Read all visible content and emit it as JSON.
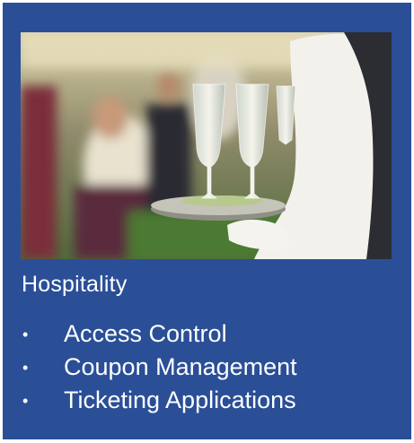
{
  "card": {
    "background": "#2a4f97",
    "image_subject": "waiter-tray-champagne-flutes",
    "title": "Hospitality",
    "bullet_glyph": "•",
    "items": [
      {
        "label": "Access Control"
      },
      {
        "label": "Coupon Management"
      },
      {
        "label": "Ticketing Applications"
      }
    ]
  }
}
